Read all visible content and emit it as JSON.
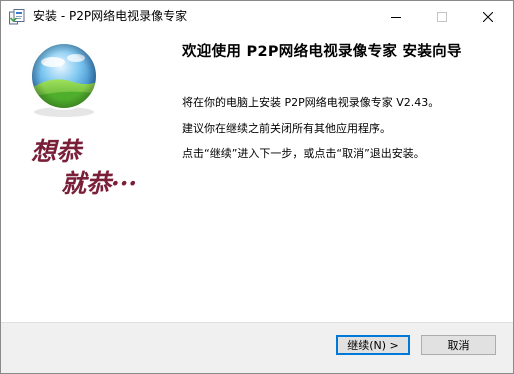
{
  "window": {
    "title": "安装 - P2P网络电视录像专家"
  },
  "left_panel": {
    "calligraphy_line1": "想恭",
    "calligraphy_line2": "就恭···"
  },
  "content": {
    "heading": "欢迎使用 P2P网络电视录像专家 安装向导",
    "line1": "将在你的电脑上安装 P2P网络电视录像专家 V2.43。",
    "line2": "建议你在继续之前关闭所有其他应用程序。",
    "line3": "点击“继续”进入下一步，或点击“取消”退出安装。"
  },
  "buttons": {
    "next_label": "继续(N) >",
    "cancel_label": "取消"
  },
  "colors": {
    "accent": "#0078d7",
    "calligraphy": "#7a1f38",
    "footer_bg": "#f0f0f0"
  }
}
